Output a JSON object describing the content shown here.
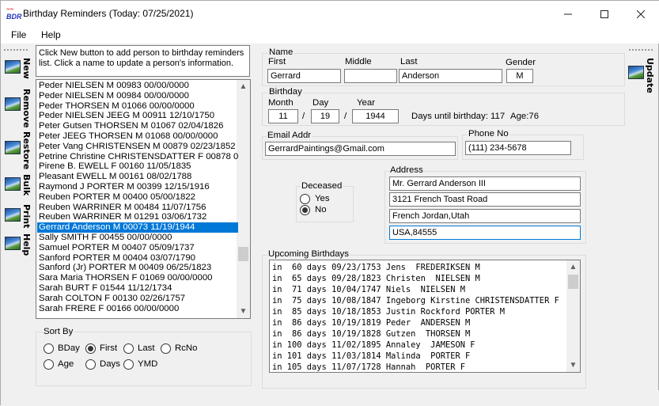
{
  "window": {
    "title": "Birthday Reminders (Today: 07/25/2021)",
    "icon_top": "~~",
    "icon_text": "BDR",
    "minimize_icon": "minimize-icon",
    "maximize_icon": "maximize-icon",
    "close_icon": "close-icon"
  },
  "menu": {
    "file": "File",
    "help": "Help"
  },
  "side_left": [
    {
      "label": "New",
      "icon": "photo-icon"
    },
    {
      "label": "Remove",
      "icon": "photo-icon"
    },
    {
      "label": "Restore",
      "icon": "photo-icon"
    },
    {
      "label": "Bulk",
      "icon": "photo-icon"
    },
    {
      "label": "Print",
      "icon": "photo-icon"
    },
    {
      "label": "Help",
      "icon": "photo-icon"
    }
  ],
  "side_right": {
    "label": "Update",
    "icon": "photo-icon"
  },
  "info_text": "Click New button to add person to birthday reminders list. Click a name to update a person's information.",
  "people": [
    "Peder  NIELSEN M 00983 00/00/0000",
    "Peder  NIELSEN M 00984 00/00/0000",
    "Peder  THORSEN M 01066 00/00/0000",
    "Peder NIELSEN JEEG M 00911 12/10/1750",
    "Peter Gutsen THORSEN M 01067 02/04/1826",
    "Peter JEEG THORSEN M 01068 00/00/0000",
    "Peter Vang CHRISTENSEN M 00879 02/23/1852",
    "Petrine Christine CHRISTENSDATTER F 00878 09/1",
    "Pirene B. EWELL F 00160 11/05/1835",
    "Pleasant  EWELL M 00161 08/02/1788",
    "Raymond J PORTER M 00399 12/15/1916",
    "Reuben  PORTER M 00400 05/00/1822",
    "Reuben  WARRINER M 00484 11/07/1756",
    "Reuben  WARRINER M 01291 03/06/1732",
    "Gerrard  Anderson M 00073 11/19/1944",
    "Sally  SMITH F 00455 00/00/0000",
    "Samuel  PORTER M 00407 05/09/1737",
    "Sanford  PORTER M 00404 03/07/1790",
    "Sanford (Jr)  PORTER M 00409 06/25/1823",
    "Sara Maria THORSEN F 01069 00/00/0000",
    "Sarah  BURT F 01544 11/12/1734",
    "Sarah  COLTON F 00130 02/26/1757",
    "Sarah  FRERE F 00166 00/00/0000"
  ],
  "selected_index": 14,
  "list_scroll_fraction": 0.78,
  "sort": {
    "title": "Sort By",
    "options": [
      "BDay",
      "First",
      "Last",
      "RcNo",
      "Age",
      "Days",
      "YMD"
    ],
    "selected": "First"
  },
  "name": {
    "group_label": "Name",
    "first_label": "First",
    "first": "Gerrard",
    "middle_label": "Middle",
    "middle": "",
    "last_label": "Last",
    "last": "Anderson",
    "gender_label": "Gender",
    "gender": "M"
  },
  "birthday": {
    "group_label": "Birthday",
    "month_label": "Month",
    "month": "11",
    "day_label": "Day",
    "day": "19",
    "year_label": "Year",
    "year": "1944",
    "sep": "/",
    "days_until": "Days until birthday: 117",
    "age": "Age:76"
  },
  "email": {
    "label": "Email Addr",
    "value": "GerrardPaintings@Gmail.com"
  },
  "phone": {
    "label": "Phone No",
    "value": "(111) 234-5678"
  },
  "deceased": {
    "label": "Deceased",
    "yes": "Yes",
    "no": "No",
    "selected": "No"
  },
  "address": {
    "label": "Address",
    "lines": [
      "Mr. Gerrard Anderson III",
      "3121 French Toast Road",
      "French Jordan,Utah",
      "USA,84555"
    ]
  },
  "upcoming": {
    "label": "Upcoming Birthdays",
    "lines": [
      "in  60 days 09/23/1753 Jens  FREDERIKSEN M",
      "in  65 days 09/28/1823 Christen  NIELSEN M",
      "in  71 days 10/04/1747 Niels  NIELSEN M",
      "in  75 days 10/08/1847 Ingeborg Kirstine CHRISTENSDATTER F",
      "in  85 days 10/18/1853 Justin Rockford PORTER M",
      "in  86 days 10/19/1819 Peder  ANDERSEN M",
      "in  86 days 10/19/1828 Gutzen  THORSEN M",
      "in 100 days 11/02/1895 Annaley  JAMESON F",
      "in 101 days 11/03/1814 Malinda  PORTER F",
      "in 105 days 11/07/1728 Hannah  PORTER F"
    ]
  }
}
